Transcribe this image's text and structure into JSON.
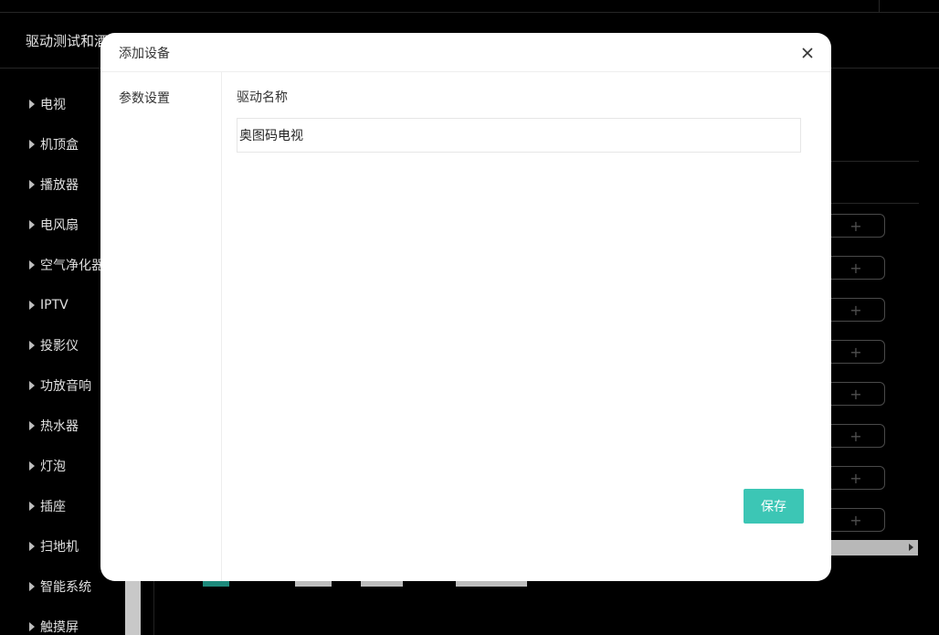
{
  "app": {
    "title": "驱动测试和酒"
  },
  "sidebar": {
    "items": [
      {
        "label": "电视"
      },
      {
        "label": "机顶盒"
      },
      {
        "label": "播放器"
      },
      {
        "label": "电风扇"
      },
      {
        "label": "空气净化器"
      },
      {
        "label": "IPTV"
      },
      {
        "label": "投影仪"
      },
      {
        "label": "功放音响"
      },
      {
        "label": "热水器"
      },
      {
        "label": "灯泡"
      },
      {
        "label": "插座"
      },
      {
        "label": "扫地机"
      },
      {
        "label": "智能系统"
      },
      {
        "label": "触摸屏"
      }
    ]
  },
  "content": {
    "add_symbol": "+"
  },
  "modal": {
    "title": "添加设备",
    "nav": {
      "param_settings": "参数设置"
    },
    "form": {
      "driver_name_label": "驱动名称",
      "driver_name_value": "奥图码电视"
    },
    "save_label": "保存"
  },
  "colors": {
    "accent": "#3cc6b5",
    "background": "#000000",
    "modal": "#ffffff"
  }
}
